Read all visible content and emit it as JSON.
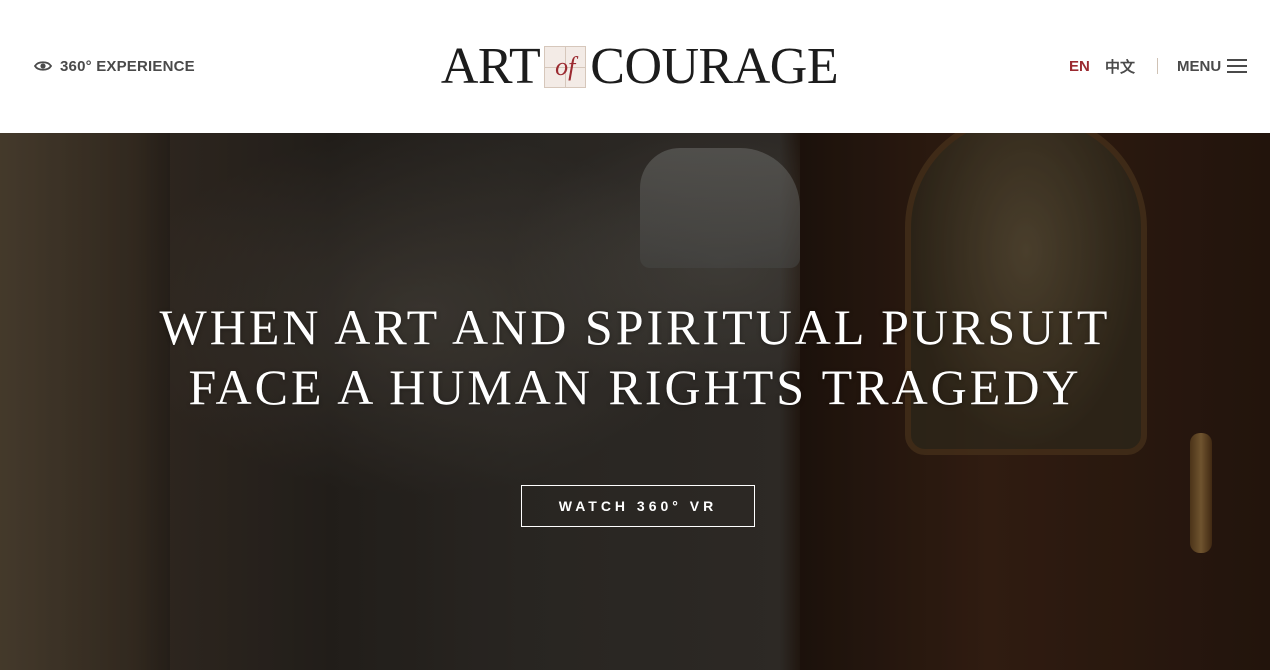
{
  "header": {
    "experience_label": "360° EXPERIENCE",
    "logo": {
      "word1": "ART",
      "word2": "of",
      "word3": "COURAGE"
    },
    "languages": [
      "EN",
      "中文"
    ],
    "active_language": "EN",
    "menu_label": "MENU"
  },
  "hero": {
    "title_line1": "WHEN ART AND SPIRITUAL PURSUIT",
    "title_line2": "FACE A HUMAN RIGHTS TRAGEDY",
    "cta_label": "WATCH 360° VR"
  },
  "colors": {
    "accent": "#9b2a30",
    "text_dark": "#4a4a4a",
    "header_bg": "#ffffff"
  },
  "icons": {
    "experience": "eye-icon",
    "menu": "hamburger-icon"
  }
}
